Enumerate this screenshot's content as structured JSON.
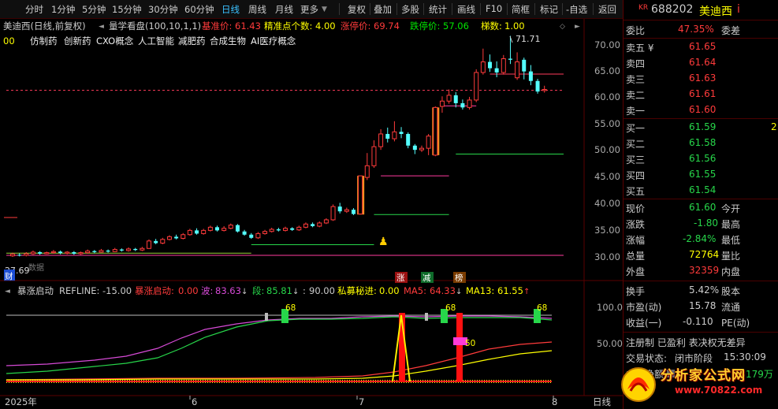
{
  "toolbar": {
    "left_items": [
      "分时",
      "1分钟",
      "5分钟",
      "15分钟",
      "30分钟",
      "60分钟",
      "日线",
      "周线",
      "月线",
      "更多"
    ],
    "active": "日线",
    "right_items": [
      "复权",
      "叠加",
      "多股",
      "统计",
      "画线",
      "F10",
      "简框",
      "标记",
      "-自选",
      "返回"
    ]
  },
  "chart_header": {
    "title": "美迪西(日线,前复权)",
    "indicator": "量学看盘(100,10,1,1)",
    "metrics": [
      {
        "label": "基准价:",
        "value": "61.43",
        "color": "#ff3b3b"
      },
      {
        "label": "精准点个数:",
        "value": "4.00",
        "color": "#ffff00"
      },
      {
        "label": "涨停价:",
        "value": "69.74",
        "color": "#ff3b3b"
      },
      {
        "label": "跌停价:",
        "value": "57.06",
        "color": "#00e600"
      },
      {
        "label": "梯数:",
        "value": "1.00",
        "color": "#ffff00"
      }
    ],
    "concepts_prefix": "00",
    "concepts": [
      "仿制药",
      "创新药",
      "CXO概念",
      "人工智能",
      "减肥药",
      "合成生物",
      "AI医疗概念"
    ]
  },
  "price_axis": [
    "70.00",
    "65.00",
    "60.00",
    "55.00",
    "50.00",
    "45.00",
    "40.00",
    "35.00",
    "30.00"
  ],
  "annotations": {
    "high": "71.71",
    "low": "27.69",
    "cai": "财",
    "no_data": "数据",
    "markers": [
      "涨",
      "减",
      "榜"
    ]
  },
  "chart_data": {
    "type": "candlestick",
    "ylim": [
      27.5,
      72.5
    ],
    "candles": [
      {
        "o": 30.2,
        "c": 30.5,
        "h": 30.8,
        "l": 30.0
      },
      {
        "o": 30.4,
        "c": 30.3,
        "h": 30.7,
        "l": 30.1
      },
      {
        "o": 30.3,
        "c": 30.6,
        "h": 30.9,
        "l": 30.1
      },
      {
        "o": 30.6,
        "c": 30.9,
        "h": 31.2,
        "l": 30.4
      },
      {
        "o": 30.9,
        "c": 30.6,
        "h": 31.1,
        "l": 30.4
      },
      {
        "o": 30.6,
        "c": 30.8,
        "h": 31.0,
        "l": 30.5
      },
      {
        "o": 30.8,
        "c": 31.0,
        "h": 31.3,
        "l": 30.6
      },
      {
        "o": 31.0,
        "c": 30.7,
        "h": 31.2,
        "l": 30.5
      },
      {
        "o": 30.7,
        "c": 30.9,
        "h": 31.1,
        "l": 30.5
      },
      {
        "o": 30.9,
        "c": 30.6,
        "h": 31.1,
        "l": 30.4
      },
      {
        "o": 30.6,
        "c": 30.8,
        "h": 31.0,
        "l": 30.4
      },
      {
        "o": 30.8,
        "c": 31.1,
        "h": 31.4,
        "l": 30.6
      },
      {
        "o": 31.1,
        "c": 30.9,
        "h": 31.3,
        "l": 30.7
      },
      {
        "o": 30.9,
        "c": 31.2,
        "h": 31.5,
        "l": 30.8
      },
      {
        "o": 31.2,
        "c": 31.0,
        "h": 31.4,
        "l": 30.8
      },
      {
        "o": 31.0,
        "c": 31.4,
        "h": 31.7,
        "l": 30.9
      },
      {
        "o": 31.4,
        "c": 31.2,
        "h": 31.6,
        "l": 31.0
      },
      {
        "o": 31.2,
        "c": 31.5,
        "h": 31.8,
        "l": 31.0
      },
      {
        "o": 31.5,
        "c": 31.3,
        "h": 31.7,
        "l": 31.1
      },
      {
        "o": 31.3,
        "c": 31.6,
        "h": 31.9,
        "l": 31.1
      },
      {
        "o": 31.6,
        "c": 33.0,
        "h": 33.3,
        "l": 31.5
      },
      {
        "o": 33.0,
        "c": 32.6,
        "h": 33.4,
        "l": 32.4
      },
      {
        "o": 32.6,
        "c": 33.3,
        "h": 33.6,
        "l": 32.4
      },
      {
        "o": 33.3,
        "c": 33.8,
        "h": 34.1,
        "l": 33.1
      },
      {
        "o": 33.8,
        "c": 33.5,
        "h": 34.2,
        "l": 33.3
      },
      {
        "o": 33.5,
        "c": 34.2,
        "h": 34.5,
        "l": 33.3
      },
      {
        "o": 34.2,
        "c": 35.0,
        "h": 35.3,
        "l": 34.0
      },
      {
        "o": 35.0,
        "c": 34.4,
        "h": 35.4,
        "l": 34.2
      },
      {
        "o": 34.4,
        "c": 35.0,
        "h": 35.3,
        "l": 34.2
      },
      {
        "o": 35.0,
        "c": 35.6,
        "h": 35.9,
        "l": 34.8
      },
      {
        "o": 35.6,
        "c": 35.0,
        "h": 35.9,
        "l": 34.8
      },
      {
        "o": 35.0,
        "c": 35.4,
        "h": 35.8,
        "l": 34.8
      },
      {
        "o": 35.4,
        "c": 36.0,
        "h": 36.3,
        "l": 35.2
      },
      {
        "o": 36.0,
        "c": 34.8,
        "h": 36.2,
        "l": 34.6
      },
      {
        "o": 34.8,
        "c": 34.2,
        "h": 35.1,
        "l": 34.0
      },
      {
        "o": 34.2,
        "c": 33.6,
        "h": 34.5,
        "l": 33.4
      },
      {
        "o": 33.6,
        "c": 34.4,
        "h": 34.7,
        "l": 33.4
      },
      {
        "o": 34.4,
        "c": 34.8,
        "h": 35.1,
        "l": 34.2
      },
      {
        "o": 34.8,
        "c": 35.2,
        "h": 35.5,
        "l": 34.6
      },
      {
        "o": 35.2,
        "c": 35.0,
        "h": 35.5,
        "l": 34.8
      },
      {
        "o": 35.0,
        "c": 35.4,
        "h": 35.7,
        "l": 34.8
      },
      {
        "o": 35.4,
        "c": 35.1,
        "h": 35.6,
        "l": 34.9
      },
      {
        "o": 35.1,
        "c": 35.6,
        "h": 35.9,
        "l": 34.9
      },
      {
        "o": 35.6,
        "c": 36.2,
        "h": 36.5,
        "l": 35.4
      },
      {
        "o": 36.2,
        "c": 35.8,
        "h": 36.5,
        "l": 35.6
      },
      {
        "o": 35.8,
        "c": 36.4,
        "h": 36.7,
        "l": 35.6
      },
      {
        "o": 36.4,
        "c": 37.0,
        "h": 37.3,
        "l": 36.2
      },
      {
        "o": 37.0,
        "c": 39.5,
        "h": 39.9,
        "l": 36.8
      },
      {
        "o": 39.5,
        "c": 38.6,
        "h": 40.2,
        "l": 38.2
      },
      {
        "o": 38.6,
        "c": 38.9,
        "h": 39.3,
        "l": 38.3
      },
      {
        "o": 38.9,
        "c": 38.1,
        "h": 39.2,
        "l": 37.9
      },
      {
        "o": 38.1,
        "c": 45.3,
        "h": 45.3,
        "l": 38.0
      },
      {
        "o": 45.0,
        "c": 47.2,
        "h": 49.6,
        "l": 44.5
      },
      {
        "o": 47.2,
        "c": 50.8,
        "h": 52.0,
        "l": 46.8
      },
      {
        "o": 50.8,
        "c": 53.2,
        "h": 54.1,
        "l": 50.2
      },
      {
        "o": 53.2,
        "c": 52.3,
        "h": 54.4,
        "l": 51.6
      },
      {
        "o": 52.3,
        "c": 53.6,
        "h": 55.6,
        "l": 51.8
      },
      {
        "o": 53.6,
        "c": 53.2,
        "h": 54.5,
        "l": 52.4
      },
      {
        "o": 53.2,
        "c": 51.0,
        "h": 53.5,
        "l": 50.5
      },
      {
        "o": 51.0,
        "c": 50.2,
        "h": 51.3,
        "l": 49.4
      },
      {
        "o": 50.2,
        "c": 50.5,
        "h": 51.0,
        "l": 49.8
      },
      {
        "o": 50.5,
        "c": 52.8,
        "h": 53.2,
        "l": 49.2
      },
      {
        "o": 49.2,
        "c": 58.2,
        "h": 58.4,
        "l": 49.0
      },
      {
        "o": 58.4,
        "c": 59.4,
        "h": 60.3,
        "l": 57.2
      },
      {
        "o": 59.4,
        "c": 60.5,
        "h": 61.6,
        "l": 58.9
      },
      {
        "o": 60.5,
        "c": 59.0,
        "h": 61.1,
        "l": 58.2
      },
      {
        "o": 59.0,
        "c": 58.2,
        "h": 59.7,
        "l": 57.8
      },
      {
        "o": 58.2,
        "c": 59.6,
        "h": 60.2,
        "l": 57.8
      },
      {
        "o": 59.6,
        "c": 64.8,
        "h": 65.4,
        "l": 59.2
      },
      {
        "o": 64.8,
        "c": 66.8,
        "h": 69.3,
        "l": 64.4
      },
      {
        "o": 66.8,
        "c": 65.6,
        "h": 68.2,
        "l": 64.9
      },
      {
        "o": 65.6,
        "c": 64.8,
        "h": 66.9,
        "l": 63.9
      },
      {
        "o": 64.8,
        "c": 67.4,
        "h": 68.1,
        "l": 64.4
      },
      {
        "o": 67.4,
        "c": 67.2,
        "h": 71.71,
        "l": 66.4
      },
      {
        "o": 63.8,
        "c": 66.8,
        "h": 68.6,
        "l": 63.4
      },
      {
        "o": 67.2,
        "c": 65.0,
        "h": 67.6,
        "l": 63.5
      },
      {
        "o": 65.0,
        "c": 63.2,
        "h": 66.2,
        "l": 62.4
      },
      {
        "o": 63.2,
        "c": 61.2,
        "h": 63.6,
        "l": 60.8
      },
      {
        "o": 61.4,
        "c": 61.6,
        "h": 62.3,
        "l": 61.0
      }
    ],
    "reference_lines": [
      {
        "price": 61.43,
        "from": 0,
        "to": 80,
        "color": "#ff3b5c",
        "dashed": true
      },
      {
        "price": 64.5,
        "from": 70,
        "to": 80,
        "color": "#ff3b5c",
        "dashed": false
      },
      {
        "price": 58.5,
        "from": 63,
        "to": 68,
        "color": "#ff3b9e",
        "dashed": false
      },
      {
        "price": 49.4,
        "from": 65,
        "to": 80,
        "color": "#27d64a",
        "dashed": false
      },
      {
        "price": 45.3,
        "from": 54,
        "to": 64,
        "color": "#ff3b9e",
        "dashed": false
      },
      {
        "price": 38.0,
        "from": 53,
        "to": 64,
        "color": "#27d64a",
        "dashed": false
      },
      {
        "price": 32.3,
        "from": 35,
        "to": 53,
        "color": "#27d64a",
        "dashed": false
      },
      {
        "price": 30.3,
        "from": 0,
        "to": 80,
        "color": "#ff3b9e",
        "dashed": false
      },
      {
        "price": 30.7,
        "from": 0,
        "to": 35,
        "color": "#9bcf3b",
        "dashed": false
      }
    ],
    "volume_bars": [
      {
        "index": 51,
        "from": 38.0,
        "to": 45.3
      },
      {
        "index": 62,
        "from": 49.2,
        "to": 58.2
      }
    ]
  },
  "sub_header": {
    "name": "暴涨启动",
    "items": [
      {
        "label": "REFLINE:",
        "value": "-15.00",
        "color": "#cccccc"
      },
      {
        "label": "暴涨启动:",
        "value": "0.00",
        "color": "#ff3b3b"
      },
      {
        "label": "波:",
        "value": "83.63",
        "color": "#d64ad6"
      },
      {
        "label": "段:",
        "value": "85.81",
        "color": "#27d64a"
      },
      {
        "label": ":",
        "value": "90.00",
        "color": "#cccccc"
      },
      {
        "label": "私募秘进:",
        "value": "0.00",
        "color": "#ffff00"
      },
      {
        "label": "MA5:",
        "value": "64.33",
        "color": "#ff3b3b"
      },
      {
        "label": "MA13:",
        "value": "61.55",
        "color": "#ffff00"
      }
    ]
  },
  "sub_axis": [
    "100.0",
    "50.00"
  ],
  "sub_labels": [
    "68",
    "68",
    "68",
    "50"
  ],
  "date_axis": [
    "2025年",
    "6",
    "7",
    "8"
  ],
  "axis_mode": "日线",
  "quote": {
    "code": "688202",
    "name": "美迪西",
    "badge": "KR",
    "info_mark": "i",
    "ratio_label": "委比",
    "ratio_value": "47.35%",
    "diff_label": "委差",
    "asks": [
      {
        "label": "卖五 ¥",
        "price": "61.65"
      },
      {
        "label": "卖四",
        "price": "61.64"
      },
      {
        "label": "卖三",
        "price": "61.63"
      },
      {
        "label": "卖二",
        "price": "61.61"
      },
      {
        "label": "卖一",
        "price": "61.60"
      }
    ],
    "bids": [
      {
        "label": "买一",
        "price": "61.59",
        "extra": "2"
      },
      {
        "label": "买二",
        "price": "61.58",
        "extra": ""
      },
      {
        "label": "买三",
        "price": "61.56",
        "extra": ""
      },
      {
        "label": "买四",
        "price": "61.55",
        "extra": ""
      },
      {
        "label": "买五",
        "price": "61.54",
        "extra": ""
      }
    ],
    "stats": [
      {
        "l1": "现价",
        "v1": "61.60",
        "c1": "#27d64a",
        "l2": "今开",
        "v2": ""
      },
      {
        "l1": "涨跌",
        "v1": "-1.80",
        "c1": "#27d64a",
        "l2": "最高",
        "v2": ""
      },
      {
        "l1": "涨幅",
        "v1": "-2.84%",
        "c1": "#27d64a",
        "l2": "最低",
        "v2": ""
      },
      {
        "l1": "总量",
        "v1": "72764",
        "c1": "#ffff00",
        "l2": "量比",
        "v2": ""
      },
      {
        "l1": "外盘",
        "v1": "32359",
        "c1": "#ff3b3b",
        "l2": "内盘",
        "v2": ""
      }
    ],
    "stats2": [
      {
        "l1": "换手",
        "v1": "5.42%",
        "c1": "#cccccc",
        "l2": "股本"
      },
      {
        "l1": "市盈(动)",
        "v1": "15.78",
        "c1": "#cccccc",
        "l2": "流通"
      },
      {
        "l1": "收益(一)",
        "v1": "-0.110",
        "c1": "#cccccc",
        "l2": "PE(动)"
      }
    ],
    "tags": "注册制 已盈利 表决权无差异",
    "trade_status_label": "交易状态:",
    "trade_status": "闭市阶段",
    "trade_time": "15:30:09",
    "net_label": "主力净额",
    "net_value": "-3179万"
  },
  "watermark": {
    "title": "分析家公式网",
    "url": "www.70822.com"
  }
}
